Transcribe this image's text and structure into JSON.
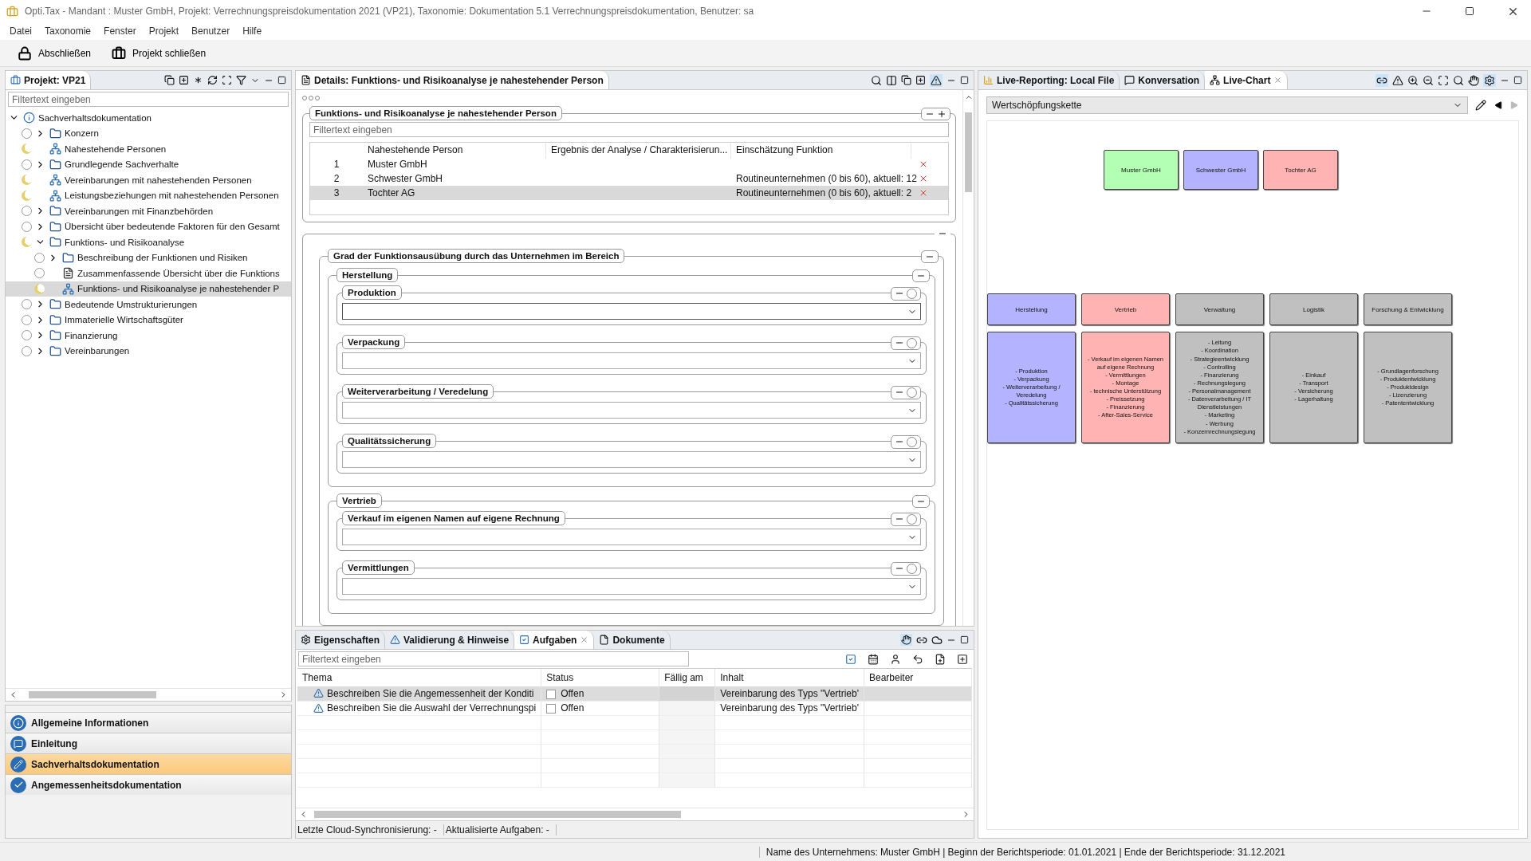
{
  "window": {
    "title": "Opti.Tax - Mandant : Muster GmbH, Projekt: Verrechnungspreisdokumentation 2021 (VP21), Taxonomie: Dokumentation 5.1 Verrechnungspreisdokumentation, Benutzer: sa"
  },
  "menu": [
    "Datei",
    "Taxonomie",
    "Fenster",
    "Projekt",
    "Benutzer",
    "Hilfe"
  ],
  "toolbar": [
    {
      "label": "Abschließen",
      "kind": "lock"
    },
    {
      "label": "Projekt schließen",
      "kind": "briefcase"
    }
  ],
  "project_panel": {
    "title": "Projekt: VP21",
    "filter_placeholder": "Filtertext eingeben",
    "tree": [
      {
        "label": "Sachverhaltsdokumentation",
        "kind": "root",
        "expanded": true,
        "selected": false,
        "children": [
          {
            "label": "Konzern",
            "kind": "folder",
            "started": false,
            "expanded": false,
            "selected": false
          },
          {
            "label": "Nahestehende Personen",
            "kind": "hierarchy",
            "started": true,
            "selected": false
          },
          {
            "label": "Grundlegende Sachverhalte",
            "kind": "folder",
            "started": false,
            "expanded": false,
            "selected": false
          },
          {
            "label": "Vereinbarungen mit nahestehenden Personen",
            "kind": "hierarchy",
            "started": true,
            "selected": false
          },
          {
            "label": "Leistungsbeziehungen mit nahestehenden Personen",
            "kind": "hierarchy",
            "started": true,
            "selected": false
          },
          {
            "label": "Vereinbarungen mit Finanzbehörden",
            "kind": "folder",
            "started": false,
            "expanded": false,
            "selected": false
          },
          {
            "label": "Übersicht über bedeutende Faktoren für den Gesamt",
            "kind": "folder",
            "started": false,
            "expanded": false,
            "selected": false
          },
          {
            "label": "Funktions- und Risikoanalyse",
            "kind": "folder",
            "started": true,
            "expanded": true,
            "selected": false,
            "children": [
              {
                "label": "Beschreibung der Funktionen und Risiken",
                "kind": "folder",
                "started": false,
                "expanded": false,
                "selected": false
              },
              {
                "label": "Zusammenfassende Übersicht über die Funktions",
                "kind": "document",
                "started": false,
                "selected": false
              },
              {
                "label": "Funktions- und Risikoanalyse je nahestehender P",
                "kind": "hierarchy",
                "started": true,
                "selected": true
              }
            ]
          },
          {
            "label": "Bedeutende Umstrukturierungen",
            "kind": "folder",
            "started": false,
            "expanded": false,
            "selected": false
          },
          {
            "label": "Immaterielle Wirtschaftsgüter",
            "kind": "folder",
            "started": false,
            "expanded": false,
            "selected": false
          },
          {
            "label": "Finanzierung",
            "kind": "folder",
            "started": false,
            "expanded": false,
            "selected": false
          },
          {
            "label": "Vereinbarungen",
            "kind": "folder",
            "started": false,
            "expanded": false,
            "selected": false
          }
        ]
      }
    ]
  },
  "navigation": [
    {
      "label": "Allgemeine Informationen",
      "kind": "info",
      "selected": false
    },
    {
      "label": "Einleitung",
      "kind": "speech",
      "selected": false
    },
    {
      "label": "Sachverhaltsdokumentation",
      "kind": "edit",
      "selected": true
    },
    {
      "label": "Angemessenheitsdokumentation",
      "kind": "check",
      "selected": false
    }
  ],
  "details": {
    "title": "Details: Funktions- und Risikoanalyse je nahestehender Person",
    "section_title": "Funktions- und Risikoanalyse je nahestehender Person",
    "filter_placeholder": "Filtertext eingeben",
    "columns": [
      "Nahestehende Person",
      "Ergebnis der Analyse / Charakterisierun...",
      "Einschätzung Funktion"
    ],
    "rows": [
      {
        "number": "1",
        "name": "Muster GmbH",
        "selected": false
      },
      {
        "number": "2",
        "name": "Schwester GmbH",
        "assessment": "Routineunternehmen (0 bis 60), aktuell: 12",
        "selected": false
      },
      {
        "number": "3",
        "name": "Tochter AG",
        "assessment": "Routineunternehmen (0 bis 60), aktuell: 2",
        "selected": true
      }
    ],
    "group_title": "Grad der Funktionsausübung durch das Unternehmen im Bereich",
    "areas": [
      {
        "title": "Herstellung",
        "fields": [
          "Produktion",
          "Verpackung",
          "Weiterverarbeitung / Veredelung",
          "Qualitätssicherung"
        ]
      },
      {
        "title": "Vertrieb",
        "fields": [
          "Verkauf im eigenen Namen auf eigene Rechnung",
          "Vermittlungen"
        ]
      }
    ]
  },
  "tasks_panel": {
    "tabs": [
      {
        "label": "Eigenschaften",
        "kind": "properties",
        "selected": false
      },
      {
        "label": "Validierung & Hinweise",
        "kind": "warning",
        "selected": false
      },
      {
        "label": "Aufgaben",
        "kind": "tasks",
        "selected": true
      },
      {
        "label": "Dokumente",
        "kind": "document",
        "selected": false
      }
    ],
    "filter_placeholder": "Filtertext eingeben",
    "columns": [
      "Thema",
      "Status",
      "Fällig am",
      "Inhalt",
      "Bearbeiter"
    ],
    "rows": [
      {
        "topic": "Beschreiben Sie die Angemessenheit der Konditi",
        "checked": false,
        "status": "Offen",
        "content": "Vereinbarung des Typs \"Vertrieb'",
        "selected": true
      },
      {
        "topic": "Beschreiben Sie die Auswahl der Verrechnungspi",
        "checked": false,
        "status": "Offen",
        "content": "Vereinbarung des Typs \"Vertrieb'",
        "selected": false
      }
    ],
    "footer": [
      "Letzte Cloud-Synchronisierung:  -",
      "Aktualisierte Aufgaben:  -"
    ]
  },
  "chart_panel": {
    "tabs": [
      {
        "label": "Live-Reporting: Local File",
        "kind": "report",
        "selected": false
      },
      {
        "label": "Konversation",
        "kind": "chat",
        "selected": false
      },
      {
        "label": "Live-Chart",
        "kind": "hierarchy",
        "selected": true
      }
    ],
    "view": "Wertschöpfungskette",
    "companies": [
      {
        "name": "Muster GmbH",
        "color": "#b3ffb3"
      },
      {
        "name": "Schwester GmbH",
        "color": "#b3b3ff"
      },
      {
        "name": "Tochter AG",
        "color": "#ffb3b3"
      }
    ],
    "functions": [
      {
        "name": "Herstellung",
        "color": "#b3b3ff",
        "items": [
          "- Produktion",
          "- Verpackung",
          "- Weiterverarbeitung / Veredelung",
          "- Qualitätssicherung"
        ]
      },
      {
        "name": "Vertrieb",
        "color": "#ffb3b3",
        "items": [
          "- Verkauf im eigenen Namen auf eigene Rechnung",
          "- Vermittlungen",
          "- Montage",
          "- technische Unterstützung",
          "- Preissetzung",
          "- Finanzierung",
          "- After-Sales-Service"
        ]
      },
      {
        "name": "Verwaltung",
        "color": "#c0c0c0",
        "items": [
          "- Leitung",
          "- Koordination",
          "- Strategieentwicklung",
          "- Controlling",
          "- Finanzierung",
          "- Rechnungslegung",
          "- Personalmanagement",
          "- Datenverarbeitung / IT Dienstleistungen",
          "- Marketing",
          "- Werbung",
          "- Konzernrechnungslegung"
        ]
      },
      {
        "name": "Logistik",
        "color": "#c0c0c0",
        "items": [
          "- Einkauf",
          "- Transport",
          "- Versicherung",
          "- Lagerhaltung"
        ]
      },
      {
        "name": "Forschung & Entwicklung",
        "color": "#c0c0c0",
        "items": [
          "- Grundlagenforschung",
          "- Produktentwicklung",
          "- Produktdesign",
          "- Lizenzierung",
          "- Patententwicklung"
        ]
      }
    ]
  },
  "status_bar": "Name des Unternehmens: Muster GmbH | Beginn der Berichtsperiode: 01.01.2021 | Ende der Berichtsperiode: 31.12.2021"
}
